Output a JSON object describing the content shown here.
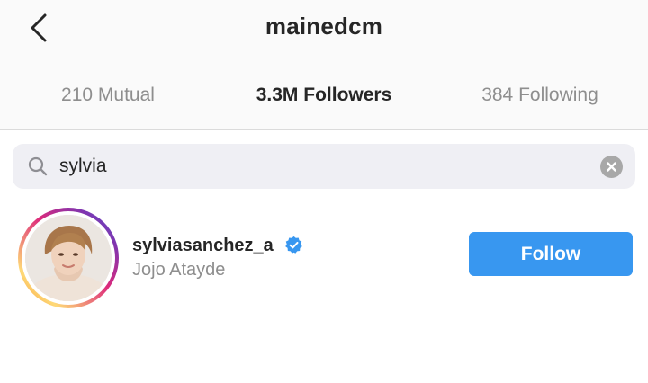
{
  "header": {
    "title": "mainedcm",
    "back_icon": "chevron-left-icon"
  },
  "tabs": [
    {
      "label": "210 Mutual",
      "active": false
    },
    {
      "label": "3.3M Followers",
      "active": true
    },
    {
      "label": "384 Following",
      "active": false
    }
  ],
  "search": {
    "value": "sylvia",
    "icon": "search-icon",
    "clear_icon": "clear-icon"
  },
  "results": [
    {
      "username": "sylviasanchez_a",
      "verified": true,
      "full_name": "Jojo Atayde",
      "button_label": "Follow",
      "has_story_ring": true
    }
  ],
  "colors": {
    "accent": "#3897f0",
    "verified_badge": "#3897f0",
    "primary_text": "#262626",
    "secondary_text": "#8e8e8e"
  }
}
